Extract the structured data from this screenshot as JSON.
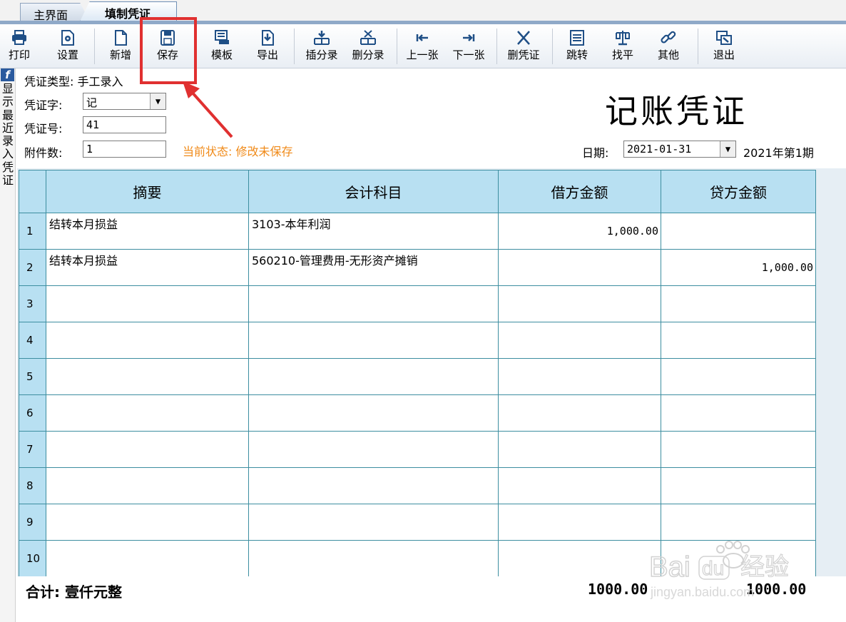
{
  "tabs": [
    {
      "label": "主界面",
      "active": false
    },
    {
      "label": "填制凭证",
      "active": true
    }
  ],
  "toolbar": {
    "print": "打印",
    "settings": "设置",
    "new": "新增",
    "save": "保存",
    "template": "模板",
    "export": "导出",
    "insert_entry": "插分录",
    "delete_entry": "删分录",
    "prev": "上一张",
    "next": "下一张",
    "delete_voucher": "删凭证",
    "jump": "跳转",
    "balance": "找平",
    "other": "其他",
    "exit": "退出"
  },
  "sidebar": {
    "label": "显示最近录入凭证"
  },
  "voucher": {
    "type_label": "凭证类型: 手工录入",
    "word_label": "凭证字:",
    "word_value": "记",
    "number_label": "凭证号:",
    "number_value": "41",
    "attach_label": "附件数:",
    "attach_value": "1",
    "status": "当前状态: 修改未保存",
    "title": "记账凭证",
    "date_label": "日期:",
    "date_value": "2021-01-31",
    "period": "2021年第1期"
  },
  "grid": {
    "headers": [
      "摘要",
      "会计科目",
      "借方金额",
      "贷方金额"
    ],
    "rows": [
      {
        "no": "1",
        "summary": "结转本月损益",
        "account": "3103-本年利润",
        "debit": "1,000.00",
        "credit": ""
      },
      {
        "no": "2",
        "summary": "结转本月损益",
        "account": "560210-管理费用-无形资产摊销",
        "debit": "",
        "credit": "1,000.00"
      },
      {
        "no": "3",
        "summary": "",
        "account": "",
        "debit": "",
        "credit": ""
      },
      {
        "no": "4",
        "summary": "",
        "account": "",
        "debit": "",
        "credit": ""
      },
      {
        "no": "5",
        "summary": "",
        "account": "",
        "debit": "",
        "credit": ""
      },
      {
        "no": "6",
        "summary": "",
        "account": "",
        "debit": "",
        "credit": ""
      },
      {
        "no": "7",
        "summary": "",
        "account": "",
        "debit": "",
        "credit": ""
      },
      {
        "no": "8",
        "summary": "",
        "account": "",
        "debit": "",
        "credit": ""
      },
      {
        "no": "9",
        "summary": "",
        "account": "",
        "debit": "",
        "credit": ""
      },
      {
        "no": "10",
        "summary": "",
        "account": "",
        "debit": "",
        "credit": ""
      }
    ]
  },
  "totals": {
    "label": "合计:  壹仟元整",
    "debit": "1000.00",
    "credit": "1000.00"
  },
  "watermark": {
    "brand": "Bai",
    "brand2": "du",
    "suffix": "经验",
    "url": "jingyan.baidu.com"
  },
  "colors": {
    "header_bg": "#b8e0f2",
    "grid_border": "#3d8ea0",
    "status": "#f08a18",
    "highlight": "#e03030"
  }
}
